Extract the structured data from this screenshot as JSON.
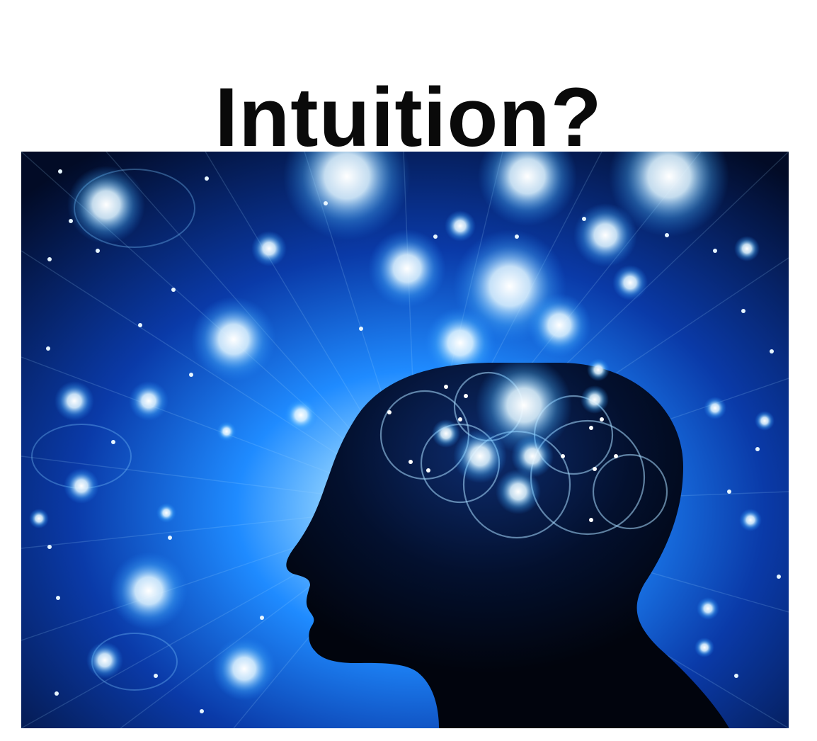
{
  "slide": {
    "title": "Intuition?",
    "illustration": {
      "icon": "glowing-head-silhouette",
      "colors": {
        "background_dark": "#020b26",
        "glow_blue": "#1f8bff",
        "glow_white": "#eaf6ff",
        "silhouette": "#01040d"
      }
    }
  }
}
